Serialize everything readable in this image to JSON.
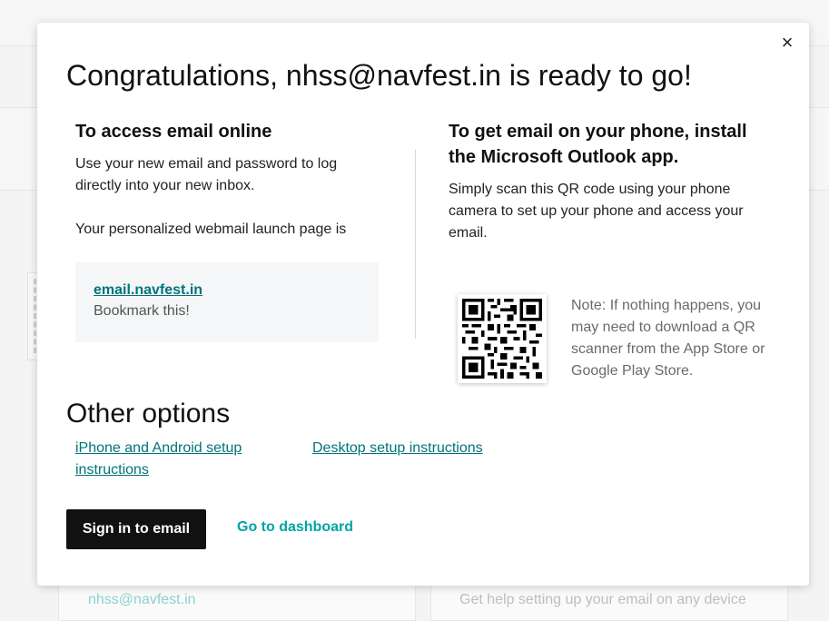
{
  "background": {
    "email_link": "nhss@navfest.in",
    "help_text": "Get help setting up your email on any device"
  },
  "modal": {
    "title": "Congratulations, nhss@navfest.in is ready to go!",
    "close_icon": "×",
    "left": {
      "heading": "To access email online",
      "para1": "Use your new email and password to log directly into your new inbox.",
      "para2": "Your personalized webmail launch page is",
      "launch_link": "email.navfest.in",
      "bookmark": "Bookmark this!"
    },
    "right": {
      "heading": "To get email on your phone, install the Microsoft Outlook app.",
      "para": "Simply scan this QR code using your phone camera to set up your phone and access your email.",
      "note": "Note: If nothing happens, you may need to download a QR scanner from the App Store or Google Play Store."
    },
    "other_options": {
      "title": "Other options",
      "iphone_link": "iPhone and Android setup instructions",
      "desktop_link": "Desktop setup instructions"
    },
    "actions": {
      "signin_label": "Sign in to email",
      "dashboard_label": "Go to dashboard"
    }
  },
  "colors": {
    "link_teal": "#00747a",
    "dashboard_teal": "#00a4a6",
    "button_black": "#111111"
  }
}
